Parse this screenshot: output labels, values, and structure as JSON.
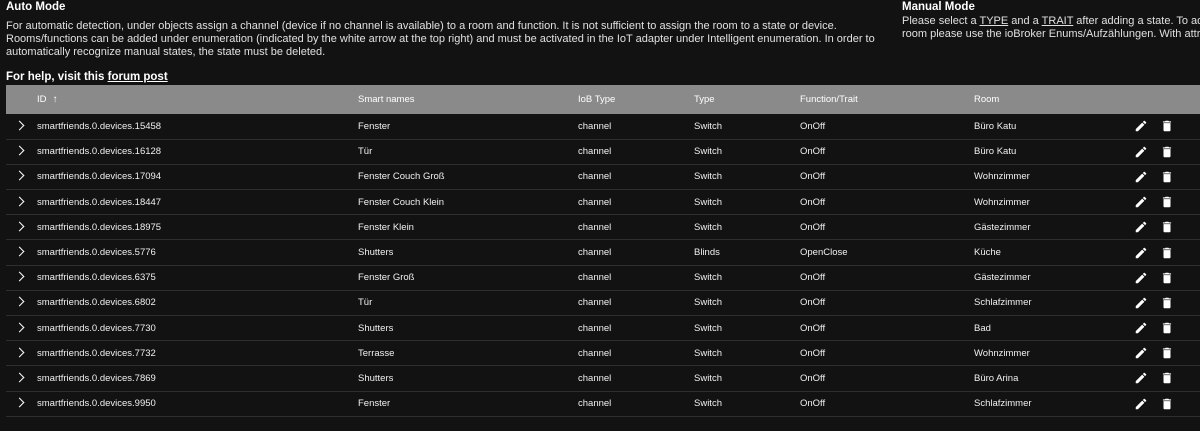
{
  "auto": {
    "title": "Auto Mode",
    "description": "For automatic detection, under objects assign a channel (device if no channel is available) to a room and function. It is not sufficient to assign the room to a state or device. Rooms/functions can be added under enumeration (indicated by the white arrow at the top right) and must be activated in the IoT adapter under Intelligent enumeration. In order to automatically recognize manual states, the state must be deleted.",
    "help_prefix": "For help, visit this ",
    "help_link": "forum post"
  },
  "manual": {
    "title": "Manual Mode",
    "line1_a": "Please select a ",
    "line1_type": "TYPE",
    "line1_b": " and a ",
    "line1_trait": "TRAIT",
    "line1_c": " after adding a state. To add multiple",
    "line2": "room please use the ioBroker Enums/Aufzählungen. With attributes y"
  },
  "table": {
    "headers": {
      "id": "ID",
      "smart_names": "Smart names",
      "iob_type": "IoB Type",
      "type": "Type",
      "function": "Function/Trait",
      "room": "Room"
    },
    "sort_icon": "arrow-up-icon",
    "rows": [
      {
        "id": "smartfriends.0.devices.15458",
        "name": "Fenster",
        "iob": "channel",
        "type": "Switch",
        "func": "OnOff",
        "room": "Büro Katu"
      },
      {
        "id": "smartfriends.0.devices.16128",
        "name": "Tür",
        "iob": "channel",
        "type": "Switch",
        "func": "OnOff",
        "room": "Büro Katu"
      },
      {
        "id": "smartfriends.0.devices.17094",
        "name": "Fenster Couch Groß",
        "iob": "channel",
        "type": "Switch",
        "func": "OnOff",
        "room": "Wohnzimmer"
      },
      {
        "id": "smartfriends.0.devices.18447",
        "name": "Fenster Couch Klein",
        "iob": "channel",
        "type": "Switch",
        "func": "OnOff",
        "room": "Wohnzimmer"
      },
      {
        "id": "smartfriends.0.devices.18975",
        "name": "Fenster Klein",
        "iob": "channel",
        "type": "Switch",
        "func": "OnOff",
        "room": "Gästezimmer"
      },
      {
        "id": "smartfriends.0.devices.5776",
        "name": "Shutters",
        "iob": "channel",
        "type": "Blinds",
        "func": "OpenClose",
        "room": "Küche"
      },
      {
        "id": "smartfriends.0.devices.6375",
        "name": "Fenster Groß",
        "iob": "channel",
        "type": "Switch",
        "func": "OnOff",
        "room": "Gästezimmer"
      },
      {
        "id": "smartfriends.0.devices.6802",
        "name": "Tür",
        "iob": "channel",
        "type": "Switch",
        "func": "OnOff",
        "room": "Schlafzimmer"
      },
      {
        "id": "smartfriends.0.devices.7730",
        "name": "Shutters",
        "iob": "channel",
        "type": "Switch",
        "func": "OnOff",
        "room": "Bad"
      },
      {
        "id": "smartfriends.0.devices.7732",
        "name": "Terrasse",
        "iob": "channel",
        "type": "Switch",
        "func": "OnOff",
        "room": "Wohnzimmer"
      },
      {
        "id": "smartfriends.0.devices.7869",
        "name": "Shutters",
        "iob": "channel",
        "type": "Switch",
        "func": "OnOff",
        "room": "Büro Arina"
      },
      {
        "id": "smartfriends.0.devices.9950",
        "name": "Fenster",
        "iob": "channel",
        "type": "Switch",
        "func": "OnOff",
        "room": "Schlafzimmer"
      }
    ]
  },
  "icons": {
    "expand": "chevron-right-icon",
    "edit": "pencil-icon",
    "delete": "trash-icon"
  },
  "colors": {
    "background": "#121212",
    "header_bg": "#8a8a8a",
    "text": "#ffffff"
  }
}
